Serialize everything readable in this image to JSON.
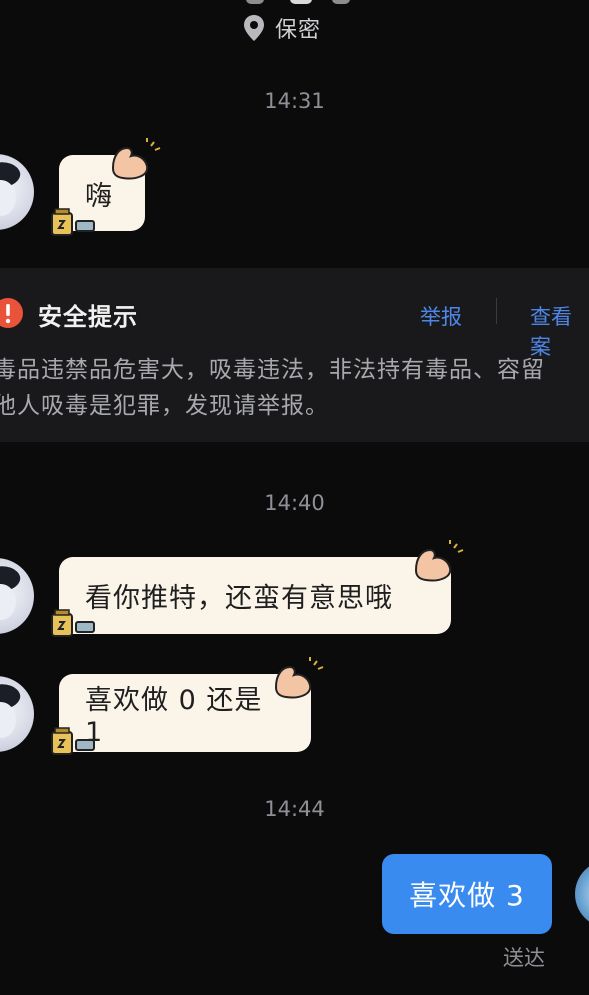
{
  "header": {
    "location": "保密"
  },
  "messages": [
    {
      "time": "14:31",
      "text": "嗨"
    },
    {
      "time": "14:40",
      "text": "看你推特，还蛮有意思哦"
    },
    {
      "text": "喜欢做 0 还是 1"
    },
    {
      "time": "14:44",
      "text": "喜欢做 3"
    }
  ],
  "safety": {
    "title": "安全提示",
    "report": "举报",
    "view": "查看案",
    "line1": "毒品违禁品危害大，吸毒违法，非法持有毒品、容留",
    "line2": "他人吸毒是犯罪，发现请举报。"
  },
  "status": {
    "delivered": "送达"
  },
  "colors": {
    "accent": "#3a8bf0",
    "bubble": "#fbf4e9",
    "warning": "#e8533a",
    "link": "#4e86e8"
  }
}
